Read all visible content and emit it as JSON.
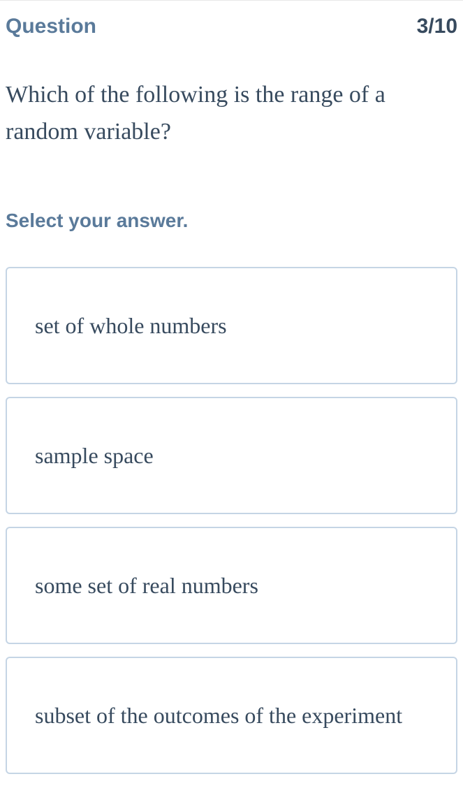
{
  "header": {
    "label": "Question",
    "progress": "3/10"
  },
  "question": {
    "text": "Which of the following is the range of a random variable?"
  },
  "instruction": "Select your answer.",
  "options": [
    {
      "text": "set of whole numbers"
    },
    {
      "text": "sample space"
    },
    {
      "text": "some set of real numbers"
    },
    {
      "text": "subset of the outcomes of the experiment"
    }
  ]
}
